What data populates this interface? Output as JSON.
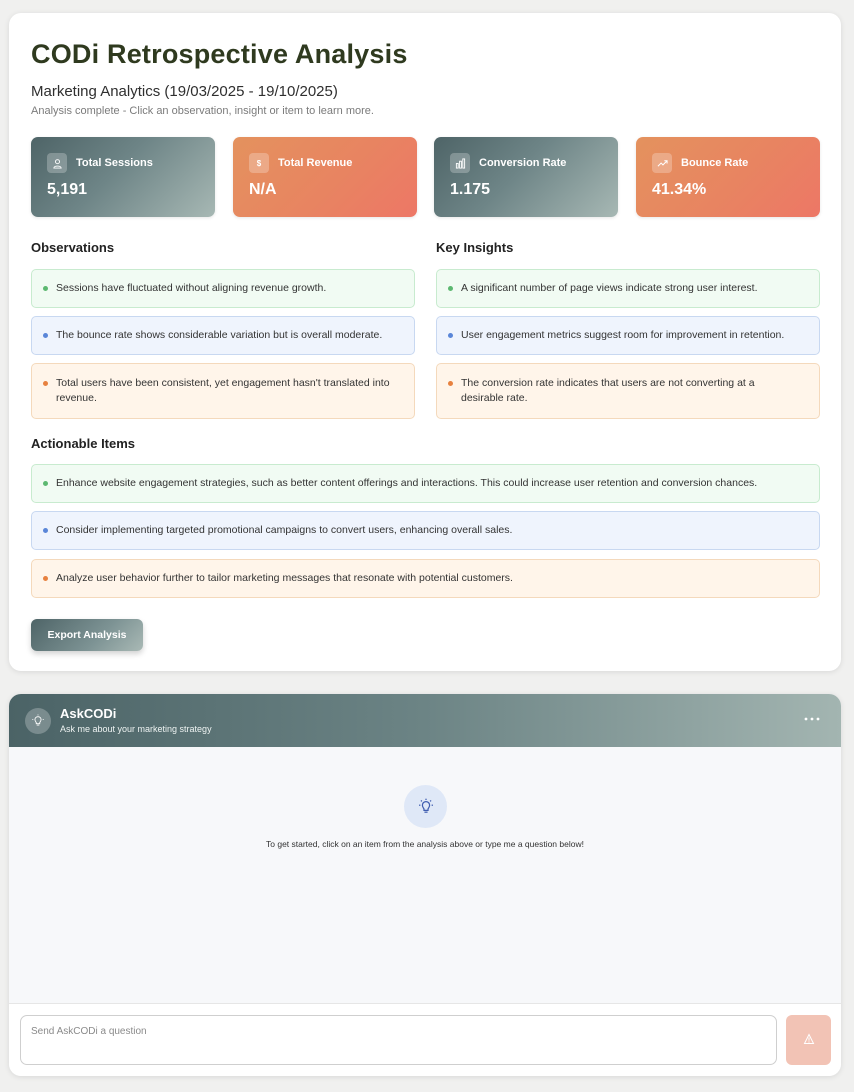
{
  "analysis": {
    "title": "CODi Retrospective Analysis",
    "subtitle": "Marketing Analytics (19/03/2025 - 19/10/2025)",
    "hint": "Analysis complete - Click an observation, insight or item to learn more.",
    "metrics": [
      {
        "label": "Total Sessions",
        "value": "5,191",
        "icon": "user-icon",
        "icon_glyph": "",
        "theme": "teal"
      },
      {
        "label": "Total Revenue",
        "value": "N/A",
        "icon": "dollar-icon",
        "icon_glyph": "$",
        "theme": "orange"
      },
      {
        "label": "Conversion Rate",
        "value": "1.175",
        "icon": "bar-chart-icon",
        "icon_glyph": "",
        "theme": "teal"
      },
      {
        "label": "Bounce Rate",
        "value": "41.34%",
        "icon": "trending-up-icon",
        "icon_glyph": "",
        "theme": "orange"
      }
    ],
    "observations": {
      "title": "Observations",
      "items": [
        "Sessions have fluctuated without aligning revenue growth.",
        "The bounce rate shows considerable variation but is overall moderate.",
        "Total users have been consistent, yet engagement hasn't translated into revenue."
      ]
    },
    "insights": {
      "title": "Key Insights",
      "items": [
        "A significant number of page views indicate strong user interest.",
        "User engagement metrics suggest room for improvement in retention.",
        "The conversion rate indicates that users are not converting at a desirable rate."
      ]
    },
    "actionable": {
      "title": "Actionable Items",
      "items": [
        "Enhance website engagement strategies, such as better content offerings and interactions. This could increase user retention and conversion chances.",
        "Consider implementing targeted promotional campaigns to convert users, enhancing overall sales.",
        "Analyze user behavior further to tailor marketing messages that resonate with potential customers."
      ]
    },
    "export_label": "Export Analysis",
    "colors": {
      "green": "#5cb870",
      "blue": "#5a86d8",
      "orange": "#e7813f",
      "accent_teal": "#4e6467",
      "accent_orange": "#ed7766"
    }
  },
  "chat": {
    "title": "AskCODi",
    "subtitle": "Ask me about your marketing strategy",
    "more_icon": "more-horizontal-icon",
    "empty_text": "To get started, click on an item from the analysis above or type me a question below!",
    "input_placeholder": "Send AskCODi a question",
    "input_value": "",
    "send_icon": "send-icon"
  }
}
